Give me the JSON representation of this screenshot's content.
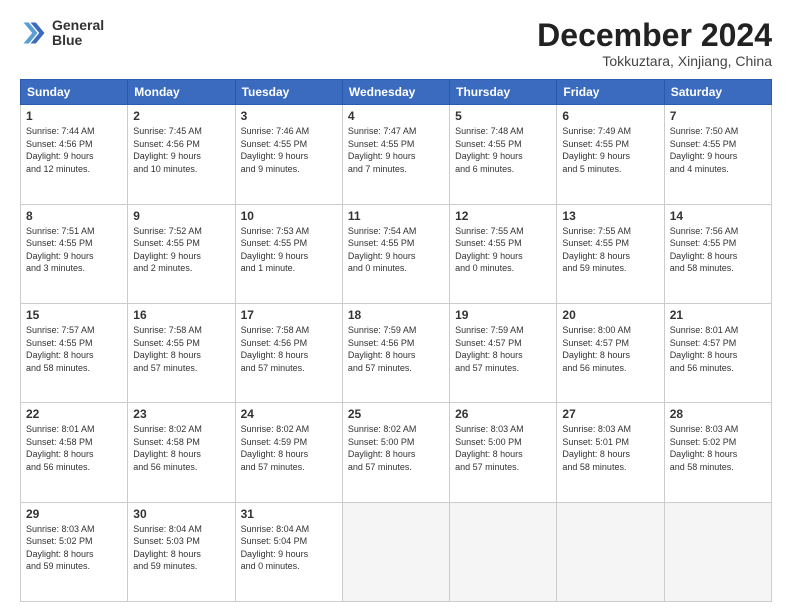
{
  "header": {
    "logo_line1": "General",
    "logo_line2": "Blue",
    "month": "December 2024",
    "location": "Tokkuztara, Xinjiang, China"
  },
  "weekdays": [
    "Sunday",
    "Monday",
    "Tuesday",
    "Wednesday",
    "Thursday",
    "Friday",
    "Saturday"
  ],
  "weeks": [
    [
      {
        "day": "1",
        "info": "Sunrise: 7:44 AM\nSunset: 4:56 PM\nDaylight: 9 hours\nand 12 minutes."
      },
      {
        "day": "2",
        "info": "Sunrise: 7:45 AM\nSunset: 4:56 PM\nDaylight: 9 hours\nand 10 minutes."
      },
      {
        "day": "3",
        "info": "Sunrise: 7:46 AM\nSunset: 4:55 PM\nDaylight: 9 hours\nand 9 minutes."
      },
      {
        "day": "4",
        "info": "Sunrise: 7:47 AM\nSunset: 4:55 PM\nDaylight: 9 hours\nand 7 minutes."
      },
      {
        "day": "5",
        "info": "Sunrise: 7:48 AM\nSunset: 4:55 PM\nDaylight: 9 hours\nand 6 minutes."
      },
      {
        "day": "6",
        "info": "Sunrise: 7:49 AM\nSunset: 4:55 PM\nDaylight: 9 hours\nand 5 minutes."
      },
      {
        "day": "7",
        "info": "Sunrise: 7:50 AM\nSunset: 4:55 PM\nDaylight: 9 hours\nand 4 minutes."
      }
    ],
    [
      {
        "day": "8",
        "info": "Sunrise: 7:51 AM\nSunset: 4:55 PM\nDaylight: 9 hours\nand 3 minutes."
      },
      {
        "day": "9",
        "info": "Sunrise: 7:52 AM\nSunset: 4:55 PM\nDaylight: 9 hours\nand 2 minutes."
      },
      {
        "day": "10",
        "info": "Sunrise: 7:53 AM\nSunset: 4:55 PM\nDaylight: 9 hours\nand 1 minute."
      },
      {
        "day": "11",
        "info": "Sunrise: 7:54 AM\nSunset: 4:55 PM\nDaylight: 9 hours\nand 0 minutes."
      },
      {
        "day": "12",
        "info": "Sunrise: 7:55 AM\nSunset: 4:55 PM\nDaylight: 9 hours\nand 0 minutes."
      },
      {
        "day": "13",
        "info": "Sunrise: 7:55 AM\nSunset: 4:55 PM\nDaylight: 8 hours\nand 59 minutes."
      },
      {
        "day": "14",
        "info": "Sunrise: 7:56 AM\nSunset: 4:55 PM\nDaylight: 8 hours\nand 58 minutes."
      }
    ],
    [
      {
        "day": "15",
        "info": "Sunrise: 7:57 AM\nSunset: 4:55 PM\nDaylight: 8 hours\nand 58 minutes."
      },
      {
        "day": "16",
        "info": "Sunrise: 7:58 AM\nSunset: 4:55 PM\nDaylight: 8 hours\nand 57 minutes."
      },
      {
        "day": "17",
        "info": "Sunrise: 7:58 AM\nSunset: 4:56 PM\nDaylight: 8 hours\nand 57 minutes."
      },
      {
        "day": "18",
        "info": "Sunrise: 7:59 AM\nSunset: 4:56 PM\nDaylight: 8 hours\nand 57 minutes."
      },
      {
        "day": "19",
        "info": "Sunrise: 7:59 AM\nSunset: 4:57 PM\nDaylight: 8 hours\nand 57 minutes."
      },
      {
        "day": "20",
        "info": "Sunrise: 8:00 AM\nSunset: 4:57 PM\nDaylight: 8 hours\nand 56 minutes."
      },
      {
        "day": "21",
        "info": "Sunrise: 8:01 AM\nSunset: 4:57 PM\nDaylight: 8 hours\nand 56 minutes."
      }
    ],
    [
      {
        "day": "22",
        "info": "Sunrise: 8:01 AM\nSunset: 4:58 PM\nDaylight: 8 hours\nand 56 minutes."
      },
      {
        "day": "23",
        "info": "Sunrise: 8:02 AM\nSunset: 4:58 PM\nDaylight: 8 hours\nand 56 minutes."
      },
      {
        "day": "24",
        "info": "Sunrise: 8:02 AM\nSunset: 4:59 PM\nDaylight: 8 hours\nand 57 minutes."
      },
      {
        "day": "25",
        "info": "Sunrise: 8:02 AM\nSunset: 5:00 PM\nDaylight: 8 hours\nand 57 minutes."
      },
      {
        "day": "26",
        "info": "Sunrise: 8:03 AM\nSunset: 5:00 PM\nDaylight: 8 hours\nand 57 minutes."
      },
      {
        "day": "27",
        "info": "Sunrise: 8:03 AM\nSunset: 5:01 PM\nDaylight: 8 hours\nand 58 minutes."
      },
      {
        "day": "28",
        "info": "Sunrise: 8:03 AM\nSunset: 5:02 PM\nDaylight: 8 hours\nand 58 minutes."
      }
    ],
    [
      {
        "day": "29",
        "info": "Sunrise: 8:03 AM\nSunset: 5:02 PM\nDaylight: 8 hours\nand 59 minutes."
      },
      {
        "day": "30",
        "info": "Sunrise: 8:04 AM\nSunset: 5:03 PM\nDaylight: 8 hours\nand 59 minutes."
      },
      {
        "day": "31",
        "info": "Sunrise: 8:04 AM\nSunset: 5:04 PM\nDaylight: 9 hours\nand 0 minutes."
      },
      null,
      null,
      null,
      null
    ]
  ]
}
